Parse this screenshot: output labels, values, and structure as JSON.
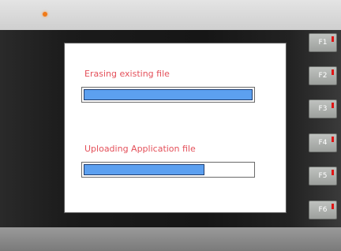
{
  "device": {
    "led_color": "#f07a18"
  },
  "screen": {
    "tasks": [
      {
        "label": "Erasing existing file",
        "progress": 1.0
      },
      {
        "label": "Uploading Application file",
        "progress": 0.72
      }
    ],
    "label_color": "#e4505a",
    "bar_color": "#5ca0f0"
  },
  "function_keys": [
    "F1",
    "F2",
    "F3",
    "F4",
    "F5",
    "F6"
  ]
}
